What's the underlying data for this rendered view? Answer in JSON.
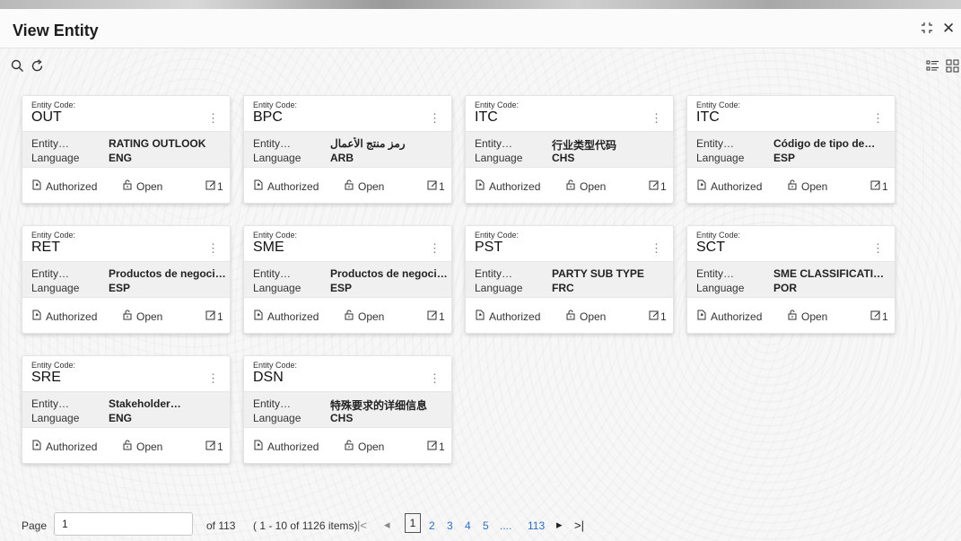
{
  "window": {
    "title": "View Entity"
  },
  "icons": {
    "minimize": "minimize-icon",
    "close": "close-icon",
    "search": "search-icon",
    "refresh": "refresh-icon",
    "list_view": "list-view-icon",
    "grid_view": "grid-view-icon"
  },
  "cards": [
    {
      "code_label": "Entity Code:",
      "code": "OUT",
      "row1_label": "Entity…",
      "row1_value": "RATING OUTLOOK",
      "row2_label": "Language",
      "row2_value": "ENG",
      "status": "Authorized",
      "lock": "Open",
      "count": "1"
    },
    {
      "code_label": "Entity Code:",
      "code": "BPC",
      "row1_label": "Entity…",
      "row1_value": "رمز منتج الأعمال",
      "row2_label": "Language",
      "row2_value": "ARB",
      "status": "Authorized",
      "lock": "Open",
      "count": "1"
    },
    {
      "code_label": "Entity Code:",
      "code": "ITC",
      "row1_label": "Entity…",
      "row1_value": "行业类型代码",
      "row2_label": "Language",
      "row2_value": "CHS",
      "status": "Authorized",
      "lock": "Open",
      "count": "1"
    },
    {
      "code_label": "Entity Code:",
      "code": "ITC",
      "row1_label": "Entity…",
      "row1_value": "Código de tipo de…",
      "row2_label": "Language",
      "row2_value": "ESP",
      "status": "Authorized",
      "lock": "Open",
      "count": "1"
    },
    {
      "code_label": "Entity Code:",
      "code": "RET",
      "row1_label": "Entity…",
      "row1_value": "Productos de negocio…",
      "row2_label": "Language",
      "row2_value": "ESP",
      "status": "Authorized",
      "lock": "Open",
      "count": "1"
    },
    {
      "code_label": "Entity Code:",
      "code": "SME",
      "row1_label": "Entity…",
      "row1_value": "Productos de negocio…",
      "row2_label": "Language",
      "row2_value": "ESP",
      "status": "Authorized",
      "lock": "Open",
      "count": "1"
    },
    {
      "code_label": "Entity Code:",
      "code": "PST",
      "row1_label": "Entity…",
      "row1_value": "PARTY SUB TYPE",
      "row2_label": "Language",
      "row2_value": "FRC",
      "status": "Authorized",
      "lock": "Open",
      "count": "1"
    },
    {
      "code_label": "Entity Code:",
      "code": "SCT",
      "row1_label": "Entity…",
      "row1_value": "SME CLASSIFICATIO…",
      "row2_label": "Language",
      "row2_value": "POR",
      "status": "Authorized",
      "lock": "Open",
      "count": "1"
    },
    {
      "code_label": "Entity Code:",
      "code": "SRE",
      "row1_label": "Entity…",
      "row1_value": "Stakeholder…",
      "row2_label": "Language",
      "row2_value": "ENG",
      "status": "Authorized",
      "lock": "Open",
      "count": "1"
    },
    {
      "code_label": "Entity Code:",
      "code": "DSN",
      "row1_label": "Entity…",
      "row1_value": "特殊要求的详细信息",
      "row2_label": "Language",
      "row2_value": "CHS",
      "status": "Authorized",
      "lock": "Open",
      "count": "1"
    }
  ],
  "pagination": {
    "page_label": "Page",
    "page_value": "1",
    "of_text": "of 113",
    "items_text": "( 1 - 10 of 1126 items)",
    "first": "|<",
    "prev": "◂",
    "current": "1",
    "pages": [
      "2",
      "3",
      "4",
      "5"
    ],
    "ellipsis": "....",
    "last_page": "113",
    "next": "▸",
    "last": ">|"
  }
}
